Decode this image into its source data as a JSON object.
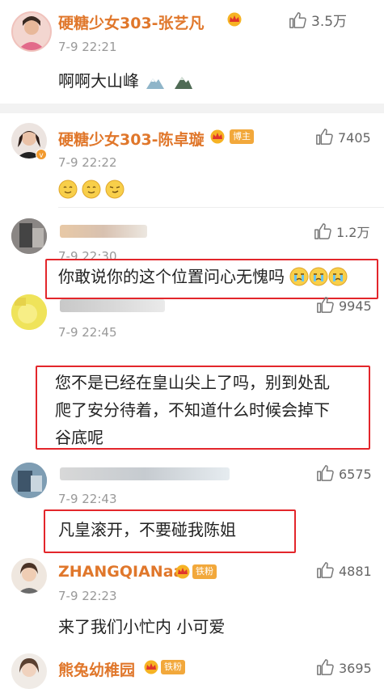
{
  "comments": [
    {
      "username": "硬糖少女303-张艺凡",
      "time": "7-9 22:21",
      "text": "啊啊大山峰",
      "likes": "3.5万"
    },
    {
      "username": "硬糖少女303-陈卓璇",
      "badge": "博主",
      "time": "7-9 22:22",
      "likes": "7405"
    },
    {
      "time": "7-9 22:30",
      "text": "你敢说你的这个位置问心无愧吗",
      "likes": "1.2万"
    },
    {
      "time": "7-9 22:45",
      "text_line1": "您不是已经在皇山尖上了吗，别到处乱",
      "text_line2": "爬了安分待着，不知道什么时候会掉下",
      "text_line3": "谷底呢",
      "likes": "9945"
    },
    {
      "time": "7-9 22:43",
      "text": "凡皇滚开，不要碰我陈姐",
      "likes": "6575"
    },
    {
      "username": "ZHANGQIANaa",
      "badge": "铁粉",
      "time": "7-9 22:23",
      "text": "来了我们小忙内 小可爱",
      "likes": "4881"
    },
    {
      "username": "熊兔幼稚园",
      "badge": "铁粉",
      "likes": "3695"
    }
  ],
  "colors": {
    "username": "#e0772b",
    "highlight": "#e3262b",
    "badge": "#f2a83b"
  },
  "icons": [
    "thumbs-up-icon",
    "crown-icon",
    "mountain-emoji",
    "smile-emoji",
    "cry-emoji"
  ]
}
